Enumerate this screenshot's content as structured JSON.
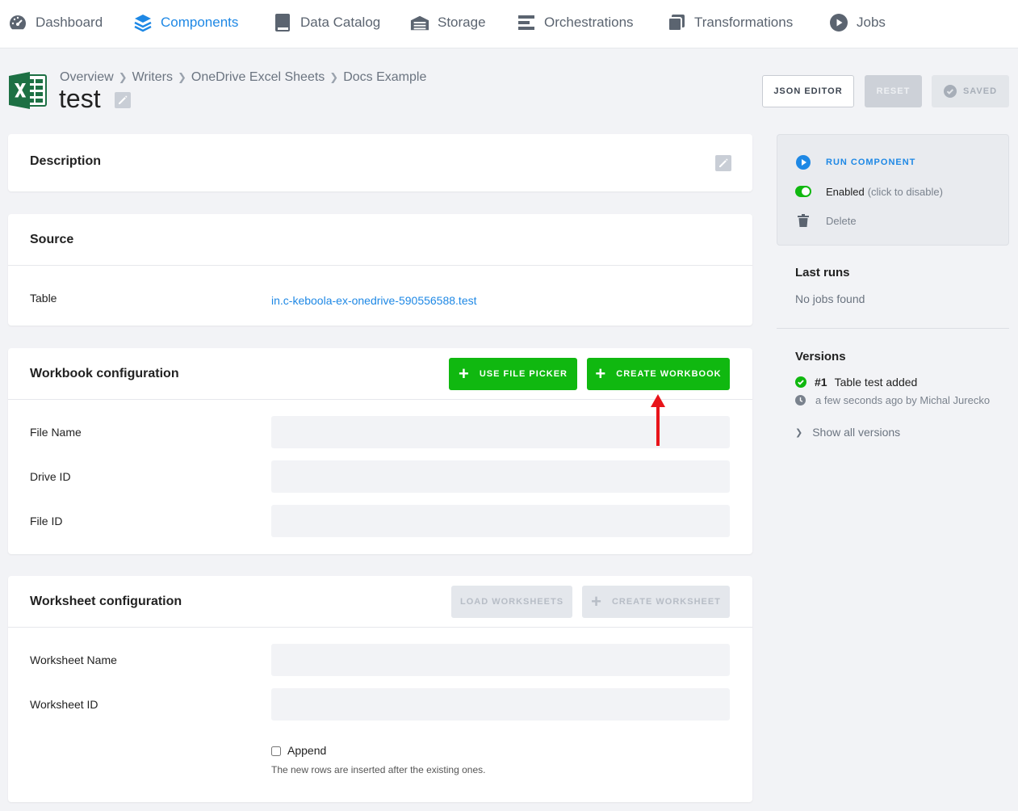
{
  "nav": {
    "items": [
      {
        "label": "Dashboard",
        "icon": "gauge-icon",
        "active": false
      },
      {
        "label": "Components",
        "icon": "layers-icon",
        "active": true
      },
      {
        "label": "Data Catalog",
        "icon": "book-icon",
        "active": false
      },
      {
        "label": "Storage",
        "icon": "warehouse-icon",
        "active": false
      },
      {
        "label": "Orchestrations",
        "icon": "bars-icon",
        "active": false
      },
      {
        "label": "Transformations",
        "icon": "window-icon",
        "active": false
      },
      {
        "label": "Jobs",
        "icon": "play-circle-icon",
        "active": false
      }
    ]
  },
  "header": {
    "breadcrumb": [
      "Overview",
      "Writers",
      "OneDrive Excel Sheets",
      "Docs Example"
    ],
    "title": "test",
    "buttons": {
      "json_editor": "JSON EDITOR",
      "reset": "RESET",
      "saved": "SAVED"
    }
  },
  "description": {
    "title": "Description"
  },
  "source": {
    "title": "Source",
    "table_label": "Table",
    "table_value": "in.c-keboola-ex-onedrive-590556588.test"
  },
  "workbook": {
    "title": "Workbook configuration",
    "use_file_picker": "USE FILE PICKER",
    "create_workbook": "CREATE WORKBOOK",
    "fields": {
      "file_name": "File Name",
      "drive_id": "Drive ID",
      "file_id": "File ID"
    }
  },
  "worksheet": {
    "title": "Worksheet configuration",
    "load_worksheets": "LOAD WORKSHEETS",
    "create_worksheet": "CREATE WORKSHEET",
    "fields": {
      "worksheet_name": "Worksheet Name",
      "worksheet_id": "Worksheet ID"
    },
    "append_label": "Append",
    "append_help": "The new rows are inserted after the existing ones."
  },
  "sidebar": {
    "run_component": "RUN COMPONENT",
    "enabled": "Enabled",
    "enabled_hint": "(click to disable)",
    "delete": "Delete",
    "last_runs_title": "Last runs",
    "last_runs_empty": "No jobs found",
    "versions_title": "Versions",
    "version_number": "#1",
    "version_desc": "Table test added",
    "version_meta": "a few seconds ago by Michal Jurecko",
    "show_all_versions": "Show all versions"
  },
  "colors": {
    "accent": "#1e88e5",
    "success": "#10b810",
    "annotation": "#e8141a"
  }
}
